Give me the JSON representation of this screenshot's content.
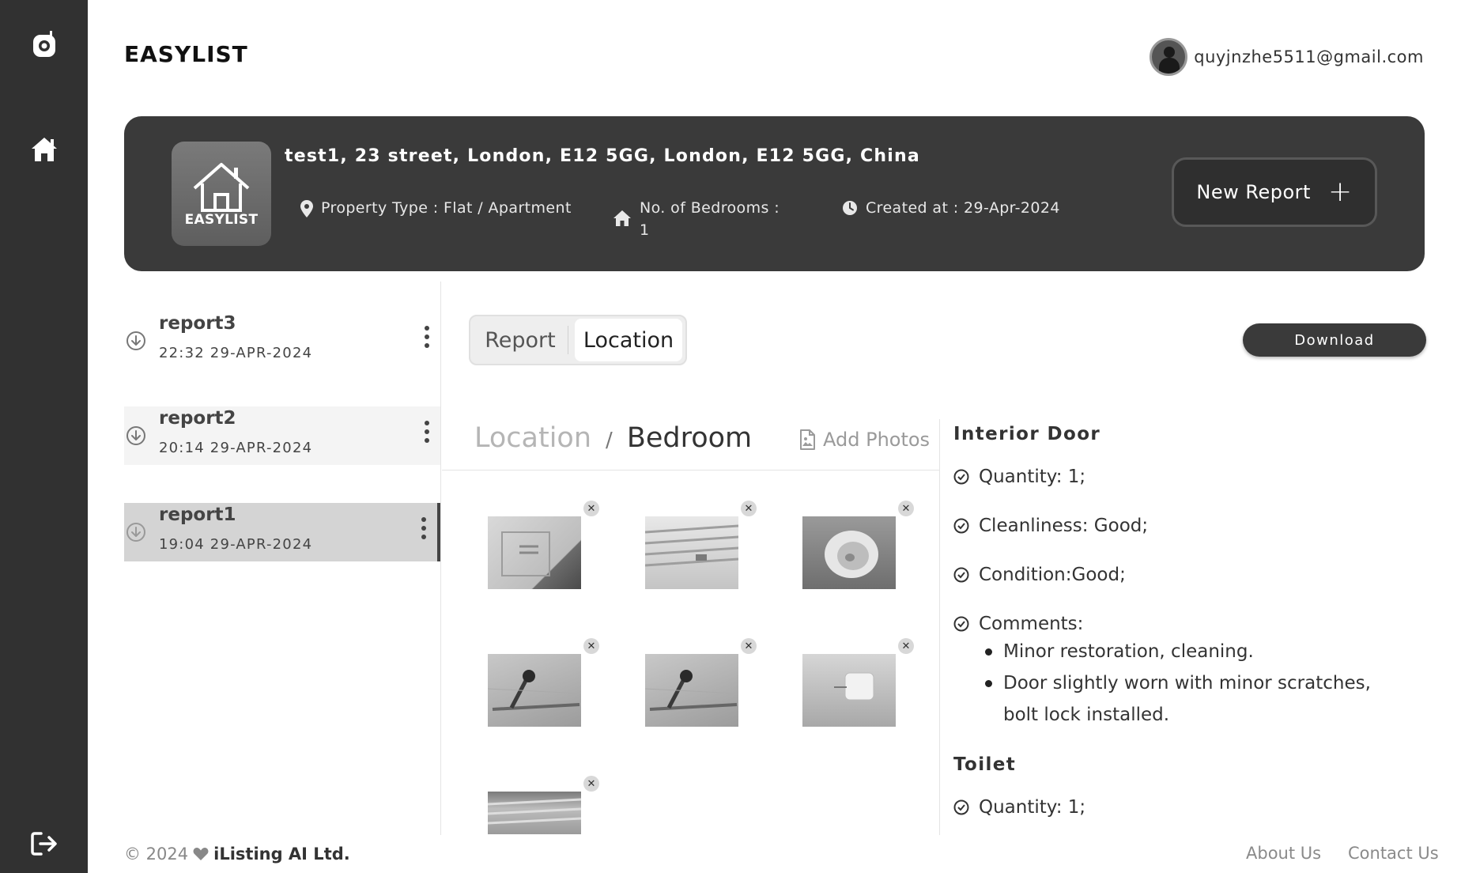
{
  "app": {
    "title": "EASYLIST"
  },
  "user": {
    "email": "quyjnzhe5511@gmail.com"
  },
  "sidebar": {
    "icons": [
      "camera-icon",
      "home-icon",
      "logout-icon"
    ]
  },
  "property": {
    "logo_text": "EASYLIST",
    "address": "test1, 23 street, London, E12 5GG, London, E12 5GG, China",
    "type": "Property Type : Flat / Apartment",
    "bedrooms_label": "No. of Bedrooms :",
    "bedrooms_value": "1",
    "created": "Created at : 29-Apr-2024",
    "new_report_label": "New Report"
  },
  "reports": [
    {
      "name": "report3",
      "date": "22:32 29-APR-2024"
    },
    {
      "name": "report2",
      "date": "20:14 29-APR-2024"
    },
    {
      "name": "report1",
      "date": "19:04 29-APR-2024"
    }
  ],
  "tabs": {
    "report": "Report",
    "location": "Location",
    "active": "Location"
  },
  "download_label": "Download",
  "location": {
    "breadcrumb_root": "Location",
    "breadcrumb_sep": "/",
    "breadcrumb_current": "Bedroom",
    "add_photos": "Add Photos",
    "photo_count": 7
  },
  "details": {
    "interior_door": {
      "title": "Interior Door",
      "quantity": "Quantity: 1;",
      "cleanliness": "Cleanliness: Good;",
      "condition": "Condition:Good;",
      "comments_label": "Comments:",
      "comments": [
        "Minor restoration, cleaning.",
        "Door slightly worn with minor scratches, bolt lock installed."
      ]
    },
    "toilet": {
      "title": "Toilet",
      "quantity": "Quantity: 1;"
    }
  },
  "footer": {
    "copyright": "© 2024",
    "company": "iListing AI Ltd.",
    "about": "About Us",
    "contact": "Contact Us"
  }
}
